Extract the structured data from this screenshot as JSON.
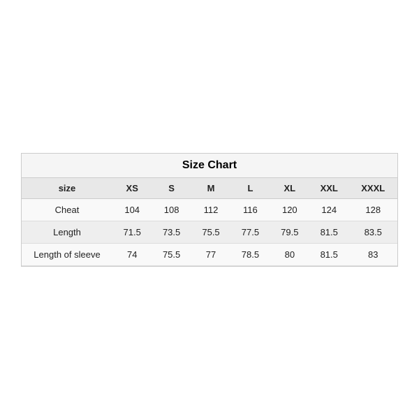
{
  "chart": {
    "title": "Size Chart",
    "headers": [
      "size",
      "XS",
      "S",
      "M",
      "L",
      "XL",
      "XXL",
      "XXXL"
    ],
    "rows": [
      {
        "label": "Cheat",
        "values": [
          "104",
          "108",
          "112",
          "116",
          "120",
          "124",
          "128"
        ]
      },
      {
        "label": "Length",
        "values": [
          "71.5",
          "73.5",
          "75.5",
          "77.5",
          "79.5",
          "81.5",
          "83.5"
        ]
      },
      {
        "label": "Length of sleeve",
        "values": [
          "74",
          "75.5",
          "77",
          "78.5",
          "80",
          "81.5",
          "83"
        ]
      }
    ]
  }
}
